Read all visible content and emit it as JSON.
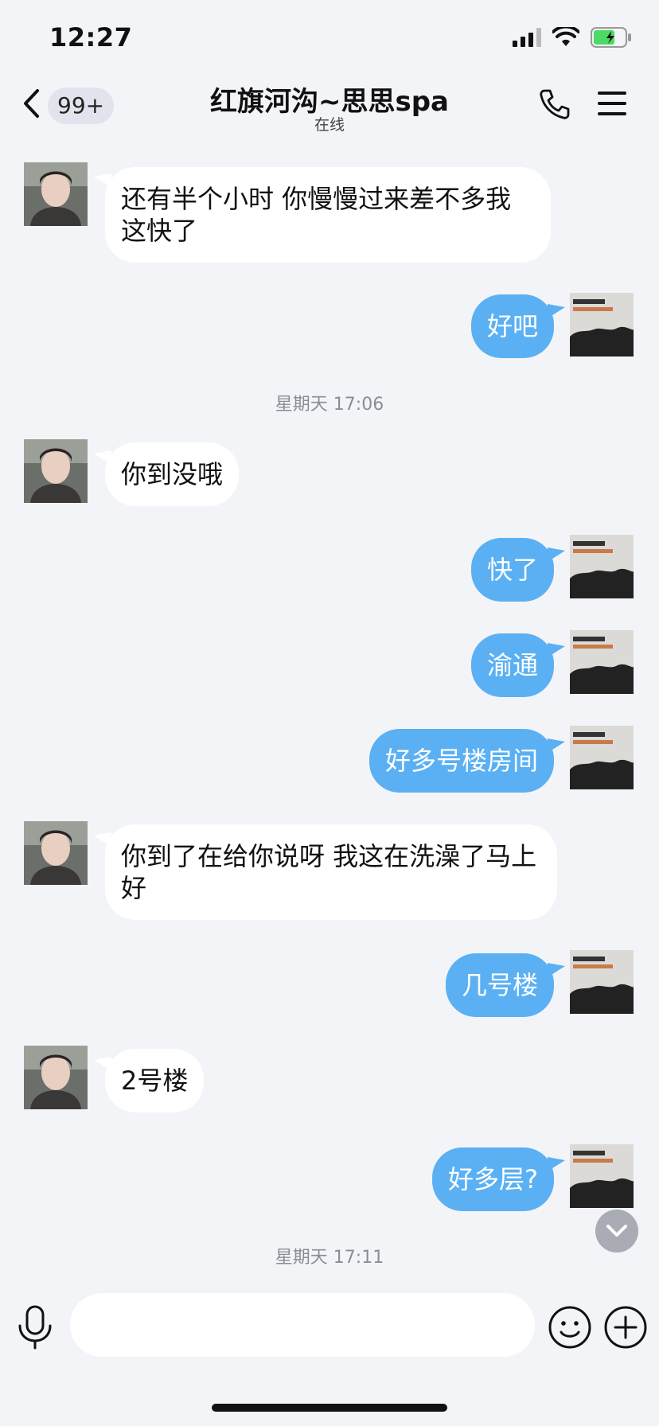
{
  "status_bar": {
    "time": "12:27"
  },
  "nav": {
    "badge": "99+",
    "title": "红旗河沟~思思spa",
    "subtitle": "在线"
  },
  "messages": [
    {
      "side": "left",
      "text": "还有半个小时  你慢慢过来差不多我这快了"
    },
    {
      "side": "right",
      "text": "好吧"
    },
    {
      "side": "left",
      "text": "你到没哦"
    },
    {
      "side": "right",
      "text": "快了"
    },
    {
      "side": "right",
      "text": "渝通"
    },
    {
      "side": "right",
      "text": "好多号楼房间"
    },
    {
      "side": "left",
      "text": "你到了在给你说呀 我这在洗澡了马上好"
    },
    {
      "side": "right",
      "text": "几号楼"
    },
    {
      "side": "left",
      "text": "2号楼"
    },
    {
      "side": "right",
      "text": "好多层?"
    }
  ],
  "timestamps": [
    "星期天 17:06",
    "星期天 17:11"
  ],
  "input": {
    "placeholder": ""
  },
  "colors": {
    "background": "#f3f4f8",
    "outgoing_bubble": "#5ab0f3",
    "incoming_bubble": "#ffffff",
    "battery": "#4cd964"
  }
}
